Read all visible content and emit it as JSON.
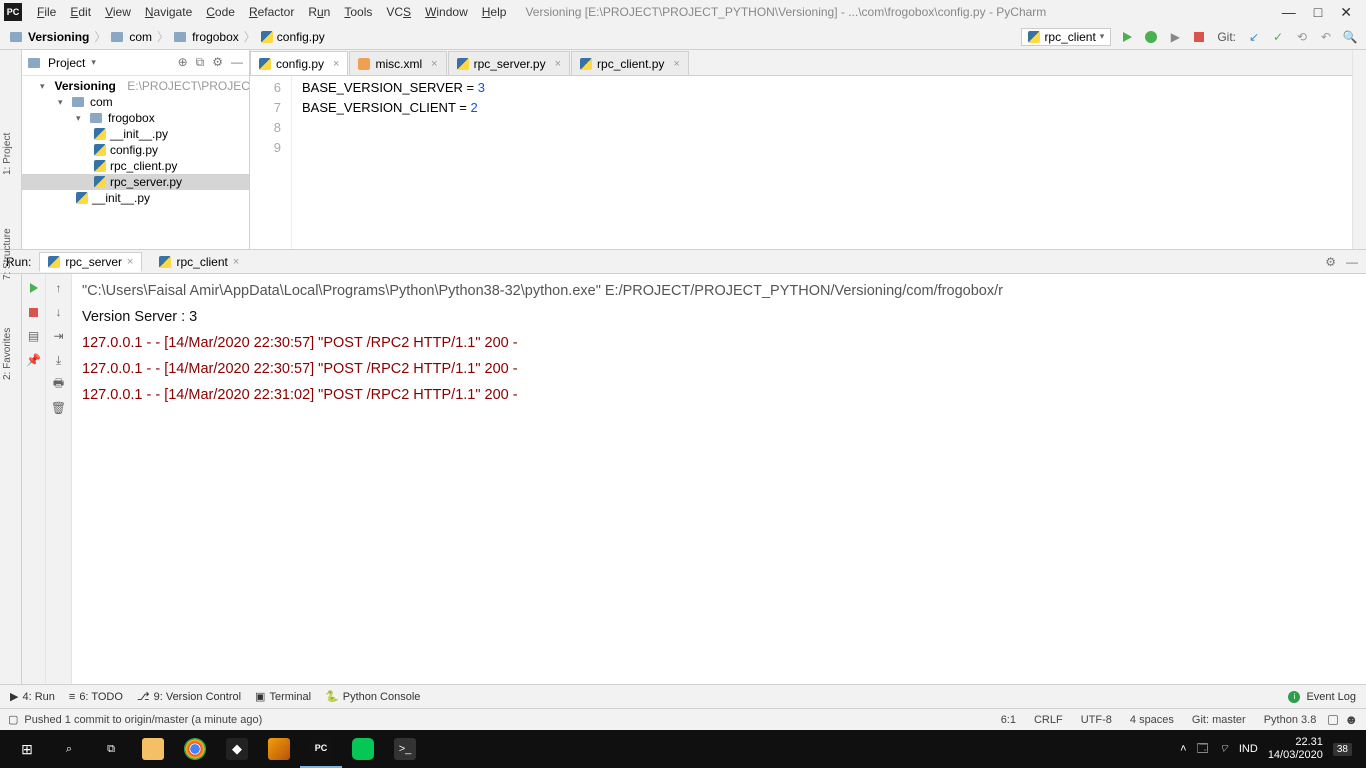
{
  "titlebar": {
    "menus": [
      "File",
      "Edit",
      "View",
      "Navigate",
      "Code",
      "Refactor",
      "Run",
      "Tools",
      "VCS",
      "Window",
      "Help"
    ],
    "path": "Versioning [E:\\PROJECT\\PROJECT_PYTHON\\Versioning] - ...\\com\\frogobox\\config.py - PyCharm"
  },
  "breadcrumb": [
    "Versioning",
    "com",
    "frogobox",
    "config.py"
  ],
  "runconfig": {
    "selected": "rpc_client",
    "git_label": "Git:"
  },
  "project": {
    "header": "Project",
    "tree": {
      "root": "Versioning",
      "root_hint": "E:\\PROJECT\\PROJECT_P",
      "com": "com",
      "frogobox": "frogobox",
      "files": [
        "__init__.py",
        "config.py",
        "rpc_client.py",
        "rpc_server.py"
      ],
      "outer_init": "__init__.py"
    }
  },
  "editor_tabs": [
    {
      "name": "config.py",
      "kind": "py",
      "active": true
    },
    {
      "name": "misc.xml",
      "kind": "xml",
      "active": false
    },
    {
      "name": "rpc_server.py",
      "kind": "py",
      "active": false
    },
    {
      "name": "rpc_client.py",
      "kind": "py",
      "active": false
    }
  ],
  "code": {
    "lines": [
      {
        "n": 6,
        "text": ""
      },
      {
        "n": 7,
        "text": "BASE_VERSION_SERVER = ",
        "num": "3"
      },
      {
        "n": 8,
        "text": "BASE_VERSION_CLIENT = ",
        "num": "2"
      },
      {
        "n": 9,
        "text": "",
        "hl": true
      }
    ]
  },
  "run": {
    "label": "Run:",
    "tabs": [
      {
        "name": "rpc_server",
        "active": true
      },
      {
        "name": "rpc_client",
        "active": false
      }
    ],
    "console": {
      "invoke": "\"C:\\Users\\Faisal Amir\\AppData\\Local\\Programs\\Python\\Python38-32\\python.exe\"  E:/PROJECT/PROJECT_PYTHON/Versioning/com/frogobox/r",
      "out": "Version Server  : 3",
      "logs": [
        "127.0.0.1 - - [14/Mar/2020 22:30:57] \"POST /RPC2 HTTP/1.1\" 200 -",
        "127.0.0.1 - - [14/Mar/2020 22:30:57] \"POST /RPC2 HTTP/1.1\" 200 -",
        "127.0.0.1 - - [14/Mar/2020 22:31:02] \"POST /RPC2 HTTP/1.1\" 200 -"
      ]
    }
  },
  "bottom_tabs": {
    "run": "4: Run",
    "todo": "6: TODO",
    "vcs": "9: Version Control",
    "terminal": "Terminal",
    "pyconsole": "Python Console",
    "eventlog": "Event Log"
  },
  "status": {
    "msg": "Pushed 1 commit to origin/master (a minute ago)",
    "pos": "6:1",
    "sep": "CRLF",
    "enc": "UTF-8",
    "indent": "4 spaces",
    "branch": "Git: master",
    "py": "Python 3.8"
  },
  "rails": {
    "project": "1: Project",
    "structure": "7: Structure",
    "favorites": "2: Favorites"
  },
  "taskbar": {
    "lang": "IND",
    "time": "22.31",
    "date": "14/03/2020",
    "notif": "38"
  }
}
